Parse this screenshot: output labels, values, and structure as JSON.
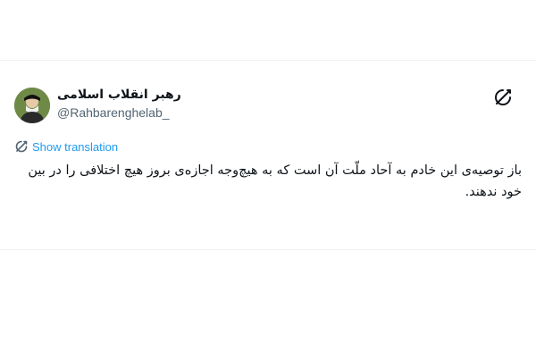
{
  "tweet": {
    "author_name": "رهبر انقلاب اسلامی",
    "author_handle": "@Rahbarenghelab_",
    "header_icon": "translate-off-icon",
    "translate_icon": "translate-icon",
    "show_translation_label": "Show translation",
    "body_text": "باز توصیه‌ی این خادم به آحاد ملّت آن است که به هیچ‌وجه اجازه‌ی بروز هیچ اختلافی را در بین خود ندهند.",
    "link_color": "#1d9bf0",
    "text_color": "#0f1419",
    "secondary_color": "#536471"
  }
}
